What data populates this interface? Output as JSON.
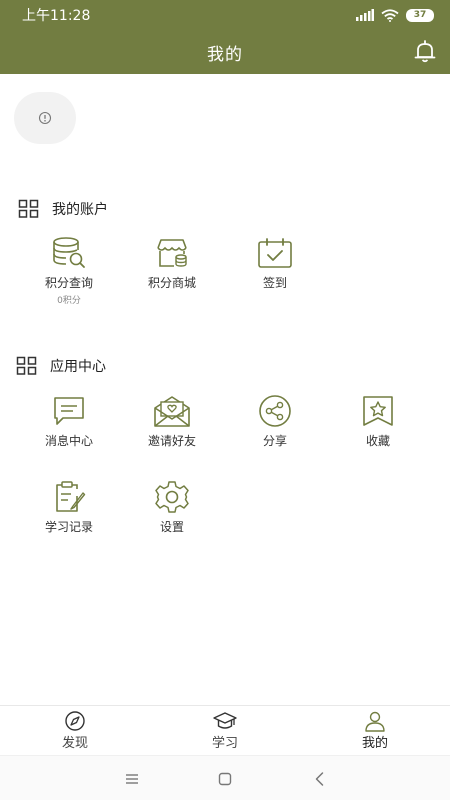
{
  "status_bar": {
    "time": "上午11:28",
    "battery": "37"
  },
  "header": {
    "title": "我的"
  },
  "account_section": {
    "title": "我的账户",
    "items": [
      {
        "label": "积分查询",
        "sub": "0积分",
        "icon": "points-query-icon"
      },
      {
        "label": "积分商城",
        "icon": "points-mall-icon"
      },
      {
        "label": "签到",
        "icon": "calendar-checkin-icon"
      }
    ]
  },
  "apps_section": {
    "title": "应用中心",
    "items": [
      {
        "label": "消息中心",
        "icon": "message-icon"
      },
      {
        "label": "邀请好友",
        "icon": "invite-envelope-icon"
      },
      {
        "label": "分享",
        "icon": "share-icon"
      },
      {
        "label": "收藏",
        "icon": "bookmark-star-icon"
      },
      {
        "label": "学习记录",
        "icon": "study-record-icon"
      },
      {
        "label": "设置",
        "icon": "gear-icon"
      }
    ]
  },
  "tabbar": {
    "items": [
      {
        "label": "发现",
        "icon": "compass-icon"
      },
      {
        "label": "学习",
        "icon": "graduation-cap-icon"
      },
      {
        "label": "我的",
        "icon": "user-icon"
      }
    ]
  },
  "colors": {
    "brand": "#727d41",
    "icon_stroke": "#727d41",
    "text": "#333333"
  }
}
